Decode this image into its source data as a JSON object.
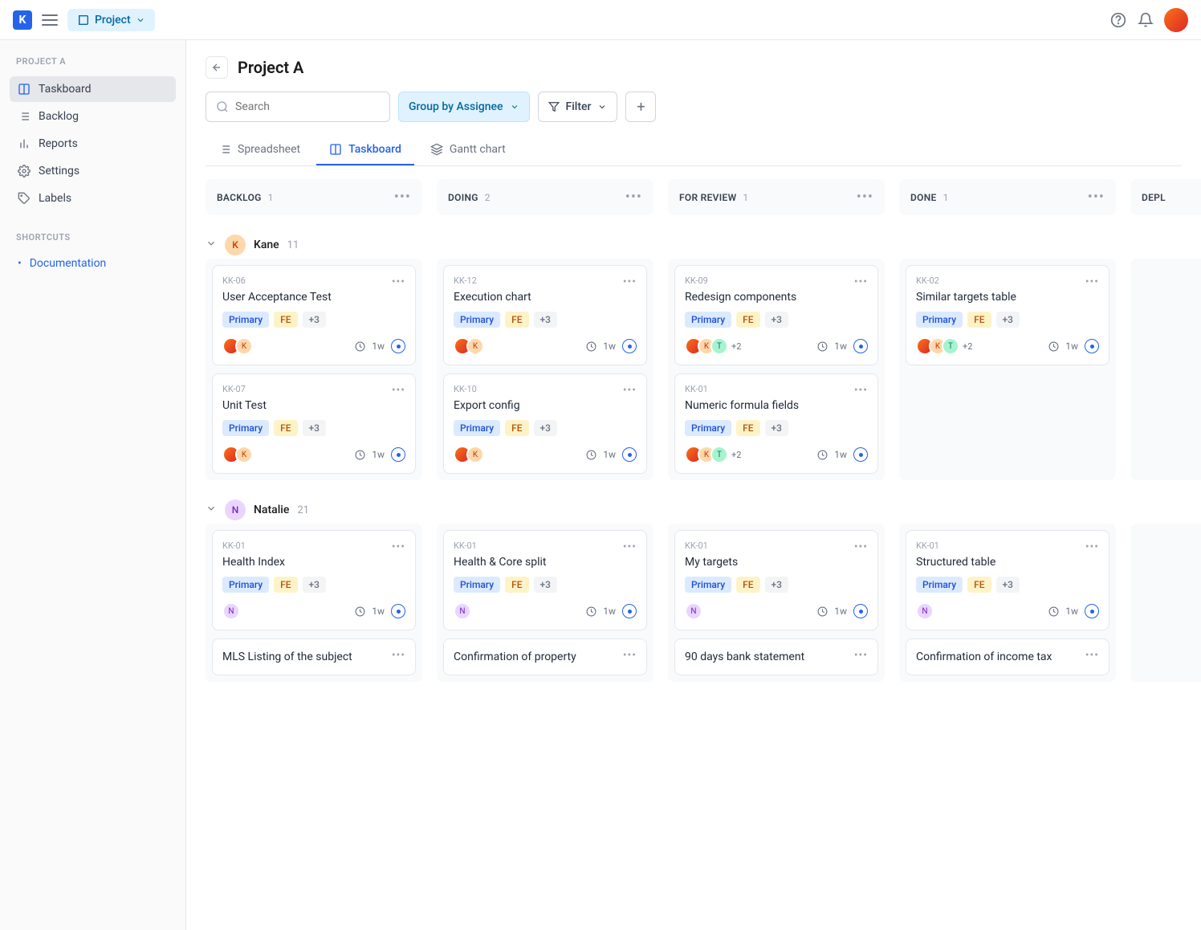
{
  "topbar": {
    "project_chip": "Project"
  },
  "sidebar": {
    "project_label": "PROJECT A",
    "items": [
      {
        "label": "Taskboard"
      },
      {
        "label": "Backlog"
      },
      {
        "label": "Reports"
      },
      {
        "label": "Settings"
      },
      {
        "label": "Labels"
      }
    ],
    "shortcuts_label": "SHORTCUTS",
    "shortcuts": [
      {
        "label": "Documentation"
      }
    ]
  },
  "header": {
    "title": "Project A",
    "search_placeholder": "Search",
    "group_by": "Group by Assignee",
    "filter": "Filter"
  },
  "tabs": [
    {
      "label": "Spreadsheet"
    },
    {
      "label": "Taskboard"
    },
    {
      "label": "Gantt chart"
    }
  ],
  "columns": [
    {
      "name": "BACKLOG",
      "count": "1"
    },
    {
      "name": "DOING",
      "count": "2"
    },
    {
      "name": "FOR REVIEW",
      "count": "1"
    },
    {
      "name": "DONE",
      "count": "1"
    },
    {
      "name": "DEPL"
    }
  ],
  "lanes": [
    {
      "avatar": "K",
      "avatar_class": "k",
      "name": "Kane",
      "count": "11",
      "cols": [
        [
          {
            "id": "KK-06",
            "title": "User Acceptance Test",
            "tags": [
              "Primary",
              "FE",
              "+3"
            ],
            "avatars": [
              "photo",
              "k"
            ],
            "due": "1w"
          },
          {
            "id": "KK-07",
            "title": "Unit Test",
            "tags": [
              "Primary",
              "FE",
              "+3"
            ],
            "avatars": [
              "photo",
              "k"
            ],
            "due": "1w"
          }
        ],
        [
          {
            "id": "KK-12",
            "title": "Execution chart",
            "tags": [
              "Primary",
              "FE",
              "+3"
            ],
            "avatars": [
              "photo",
              "k"
            ],
            "due": "1w"
          },
          {
            "id": "KK-10",
            "title": "Export config",
            "tags": [
              "Primary",
              "FE",
              "+3"
            ],
            "avatars": [
              "photo",
              "k"
            ],
            "due": "1w"
          }
        ],
        [
          {
            "id": "KK-09",
            "title": "Redesign components",
            "tags": [
              "Primary",
              "FE",
              "+3"
            ],
            "avatars": [
              "photo",
              "k",
              "t"
            ],
            "more": "+2",
            "due": "1w"
          },
          {
            "id": "KK-01",
            "title": "Numeric formula fields",
            "tags": [
              "Primary",
              "FE",
              "+3"
            ],
            "avatars": [
              "photo",
              "k",
              "t"
            ],
            "more": "+2",
            "due": "1w"
          }
        ],
        [
          {
            "id": "KK-02",
            "title": "Similar targets table",
            "tags": [
              "Primary",
              "FE",
              "+3"
            ],
            "avatars": [
              "photo",
              "k",
              "t"
            ],
            "more": "+2",
            "due": "1w"
          }
        ],
        []
      ]
    },
    {
      "avatar": "N",
      "avatar_class": "n",
      "name": "Natalie",
      "count": "21",
      "cols": [
        [
          {
            "id": "KK-01",
            "title": "Health Index",
            "tags": [
              "Primary",
              "FE",
              "+3"
            ],
            "avatars": [
              "n"
            ],
            "due": "1w"
          },
          {
            "simple": "MLS Listing of the subject"
          }
        ],
        [
          {
            "id": "KK-01",
            "title": "Health & Core split",
            "tags": [
              "Primary",
              "FE",
              "+3"
            ],
            "avatars": [
              "n"
            ],
            "due": "1w"
          },
          {
            "simple": "Confirmation of property"
          }
        ],
        [
          {
            "id": "KK-01",
            "title": "My targets",
            "tags": [
              "Primary",
              "FE",
              "+3"
            ],
            "avatars": [
              "n"
            ],
            "due": "1w"
          },
          {
            "simple": "90 days bank statement"
          }
        ],
        [
          {
            "id": "KK-01",
            "title": "Structured table",
            "tags": [
              "Primary",
              "FE",
              "+3"
            ],
            "avatars": [
              "n"
            ],
            "due": "1w"
          },
          {
            "simple": "Confirmation of income tax"
          }
        ],
        []
      ]
    }
  ]
}
